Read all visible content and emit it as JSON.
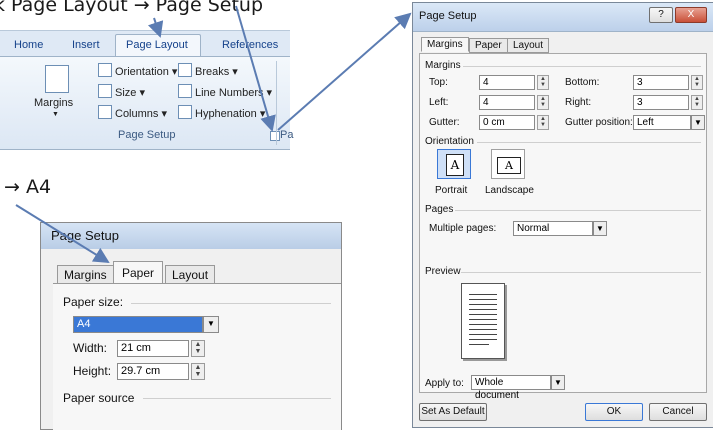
{
  "slide": {
    "top_text": "k Page Layout → Page Setup",
    "left_text": "→ A4"
  },
  "ribbon": {
    "tabs": [
      "Home",
      "Insert",
      "Page Layout",
      "References"
    ],
    "margins_label": "Margins",
    "orientation_label": "Orientation ▾",
    "size_label": "Size ▾",
    "columns_label": "Columns ▾",
    "breaks_label": "Breaks ▾",
    "line_numbers_label": "Line Numbers ▾",
    "hyphenation_label": "Hyphenation ▾",
    "group_label": "Page Setup",
    "cut_label": "Pa"
  },
  "small_dialog": {
    "title": "Page Setup",
    "tabs": [
      "Margins",
      "Paper",
      "Layout"
    ],
    "paper_size_label": "Paper size:",
    "paper_size_value": "A4",
    "width_label": "Width:",
    "width_value": "21 cm",
    "height_label": "Height:",
    "height_value": "29.7 cm",
    "paper_source_label": "Paper source"
  },
  "big_dialog": {
    "title": "Page Setup",
    "tabs": [
      "Margins",
      "Paper",
      "Layout"
    ],
    "margins_section": "Margins",
    "top_label": "Top:",
    "top_value": "4",
    "bottom_label": "Bottom:",
    "bottom_value": "3",
    "left_label": "Left:",
    "left_value": "4",
    "right_label": "Right:",
    "right_value": "3",
    "gutter_label": "Gutter:",
    "gutter_value": "0 cm",
    "gutter_pos_label": "Gutter position:",
    "gutter_pos_value": "Left",
    "orientation_section": "Orientation",
    "portrait_label": "Portrait",
    "landscape_label": "Landscape",
    "pages_section": "Pages",
    "multiple_pages_label": "Multiple pages:",
    "multiple_pages_value": "Normal",
    "preview_section": "Preview",
    "apply_to_label": "Apply to:",
    "apply_to_value": "Whole document",
    "set_default_label": "Set As Default",
    "ok_label": "OK",
    "cancel_label": "Cancel",
    "help_label": "?",
    "close_label": "X"
  }
}
